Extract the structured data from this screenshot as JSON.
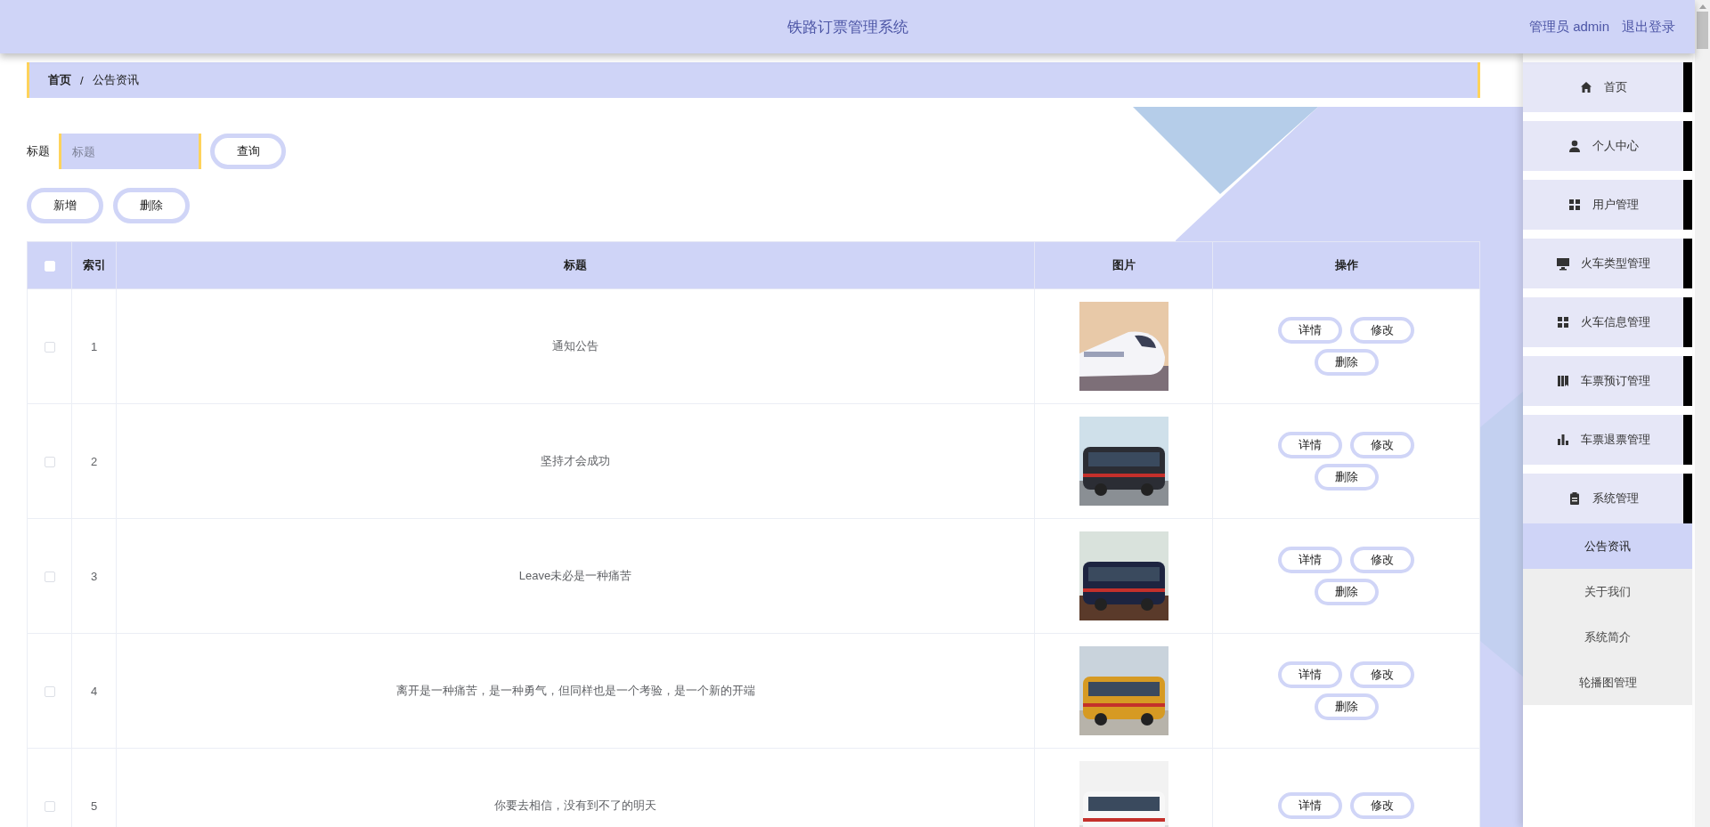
{
  "header": {
    "title": "铁路订票管理系统",
    "user": "管理员 admin",
    "logout": "退出登录"
  },
  "breadcrumb": {
    "separator": "/",
    "items": [
      {
        "label": "首页",
        "current": false
      },
      {
        "label": "公告资讯",
        "current": true
      }
    ]
  },
  "search": {
    "label": "标题",
    "placeholder": "标题",
    "button": "查询"
  },
  "toolbar": [
    "新增",
    "删除"
  ],
  "table": {
    "columns": [
      {
        "kind": "checkbox",
        "checked": false
      },
      {
        "kind": "text",
        "label": "索引"
      },
      {
        "kind": "text",
        "label": "标题"
      },
      {
        "kind": "text",
        "label": "图片"
      },
      {
        "kind": "text",
        "label": "操作"
      }
    ],
    "rows": [
      {
        "checked": false,
        "index": "1",
        "title": "通知公告",
        "picture": {
          "kind": "picture"
        },
        "actions": [
          "详情",
          "修改",
          "删除"
        ]
      },
      {
        "checked": false,
        "index": "2",
        "title": "坚持才会成功",
        "picture": {
          "kind": "picture"
        },
        "actions": [
          "详情",
          "修改",
          "删除"
        ]
      },
      {
        "checked": false,
        "index": "3",
        "title": "Leave未必是一种痛苦",
        "picture": {
          "kind": "picture"
        },
        "actions": [
          "详情",
          "修改",
          "删除"
        ]
      },
      {
        "checked": false,
        "index": "4",
        "title": "离开是一种痛苦，是一种勇气，但同样也是一个考验，是一个新的开端",
        "picture": {
          "kind": "picture"
        },
        "actions": [
          "详情",
          "修改",
          "删除"
        ]
      },
      {
        "checked": false,
        "index": "5",
        "title": "你要去相信，没有到不了的明天",
        "picture": {
          "kind": "picture"
        },
        "actions": [
          "详情",
          "修改"
        ]
      }
    ]
  },
  "sidebar": {
    "items": [
      {
        "label": "首页"
      },
      {
        "label": "个人中心"
      },
      {
        "label": "用户管理"
      },
      {
        "label": "火车类型管理"
      },
      {
        "label": "火车信息管理"
      },
      {
        "label": "车票预订管理"
      },
      {
        "label": "车票退票管理"
      },
      {
        "label": "系统管理",
        "children": [
          {
            "label": "公告资讯",
            "selected": true
          },
          {
            "label": "关于我们",
            "selected": false
          },
          {
            "label": "系统简介",
            "selected": false
          },
          {
            "label": "轮播图管理",
            "selected": false
          }
        ]
      }
    ]
  }
}
